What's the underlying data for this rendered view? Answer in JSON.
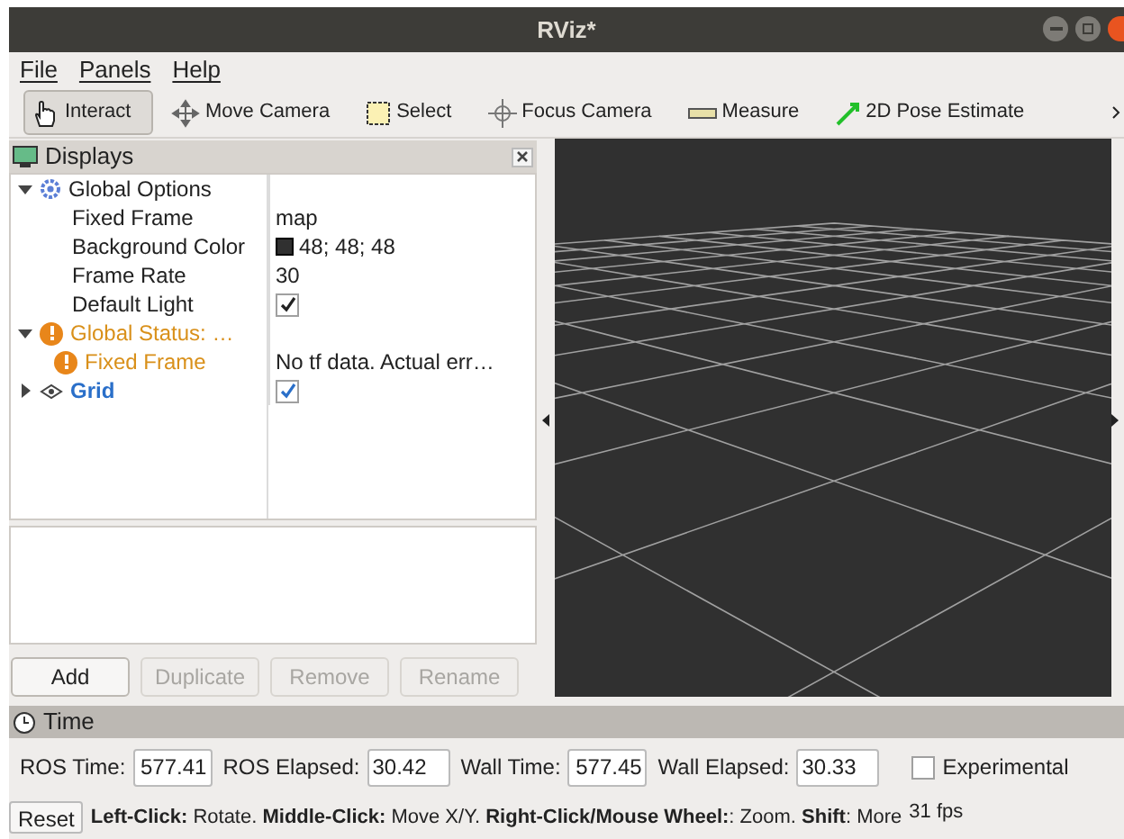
{
  "window": {
    "title": "RViz*"
  },
  "menu": [
    "File",
    "Panels",
    "Help"
  ],
  "toolbar": [
    {
      "label": "Interact",
      "selected": true
    },
    {
      "label": "Move Camera",
      "selected": false
    },
    {
      "label": "Select",
      "selected": false
    },
    {
      "label": "Focus Camera",
      "selected": false
    },
    {
      "label": "Measure",
      "selected": false
    },
    {
      "label": "2D Pose Estimate",
      "selected": false
    }
  ],
  "displays": {
    "title": "Displays",
    "tree": [
      {
        "kind": "options",
        "label": "Global Options",
        "expanded": true,
        "children": [
          {
            "kind": "property",
            "label": "Fixed Frame",
            "value": "map"
          },
          {
            "kind": "property",
            "label": "Background Color",
            "value": "48; 48; 48",
            "color": "#303030"
          },
          {
            "kind": "property",
            "label": "Frame Rate",
            "value": "30"
          },
          {
            "kind": "property",
            "label": "Default Light",
            "checked": true
          }
        ]
      },
      {
        "kind": "warning",
        "label": "Global Status: …",
        "expanded": true,
        "children": [
          {
            "kind": "warning",
            "label": "Fixed Frame",
            "value": "No tf data.  Actual err…"
          }
        ]
      },
      {
        "kind": "display",
        "label": "Grid",
        "expanded": false,
        "checked": true
      }
    ],
    "buttons": [
      {
        "label": "Add",
        "disabled": false
      },
      {
        "label": "Duplicate",
        "disabled": true
      },
      {
        "label": "Remove",
        "disabled": true
      },
      {
        "label": "Rename",
        "disabled": true
      }
    ]
  },
  "time": {
    "title": "Time",
    "fields": [
      {
        "label": "ROS Time:",
        "value": "577.41"
      },
      {
        "label": "ROS Elapsed:",
        "value": "30.42"
      },
      {
        "label": "Wall Time:",
        "value": "577.45"
      },
      {
        "label": "Wall Elapsed:",
        "value": "30.33"
      }
    ],
    "experimental": {
      "label": "Experimental",
      "checked": false
    }
  },
  "status_bar": {
    "button": "Reset",
    "hint": "**Left-Click:** Rotate. **Middle-Click:** Move X/Y. **Right-Click/Mouse Wheel:**: Zoom. **Shift**: More",
    "fps": "31 fps"
  }
}
